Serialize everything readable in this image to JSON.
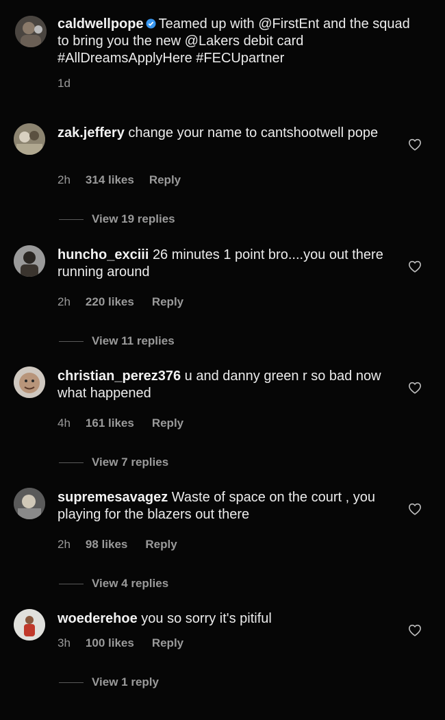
{
  "caption": {
    "username": "caldwellpope",
    "verified": true,
    "text": "Teamed up with @FirstEnt and the squad to bring you the new @Lakers debit card #AllDreamsApplyHere #FECUpartner",
    "time": "1d"
  },
  "comments": [
    {
      "username": "zak.jeffery",
      "text": "change your name to cantshootwell pope",
      "time": "2h",
      "likes": "314 likes",
      "reply": "Reply",
      "view_replies": "View 19 replies"
    },
    {
      "username": "huncho_exciii",
      "text": "26 minutes 1 point bro....you out there running around",
      "time": "2h",
      "likes": "220 likes",
      "reply": "Reply",
      "view_replies": "View 11 replies"
    },
    {
      "username": "christian_perez376",
      "text": "u and danny green r so bad now what happened",
      "time": "4h",
      "likes": "161 likes",
      "reply": "Reply",
      "view_replies": "View 7 replies"
    },
    {
      "username": "supremesavagez",
      "text": "Waste of space on the court , you playing for the blazers out there",
      "time": "2h",
      "likes": "98 likes",
      "reply": "Reply",
      "view_replies": "View 4 replies"
    },
    {
      "username": "woederehoe",
      "text": "you so sorry it's pitiful",
      "time": "3h",
      "likes": "100 likes",
      "reply": "Reply",
      "view_replies": "View 1 reply"
    }
  ],
  "icons": {
    "heart": "heart-outline-icon",
    "verified": "verified-badge-icon"
  },
  "colors": {
    "background": "#060606",
    "verified": "#3897f0",
    "meta": "#9a9a9a"
  }
}
